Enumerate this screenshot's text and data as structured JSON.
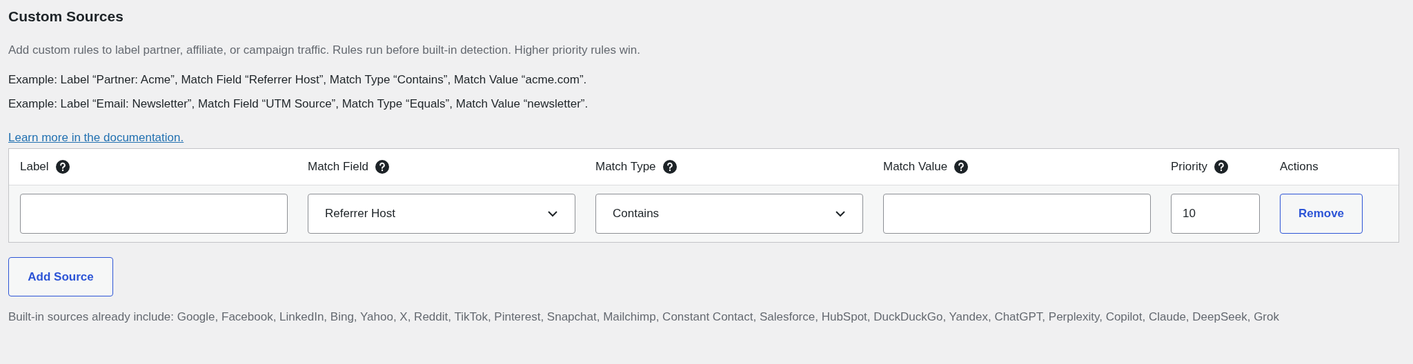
{
  "heading": "Custom Sources",
  "description": "Add custom rules to label partner, affiliate, or campaign traffic. Rules run before built-in detection. Higher priority rules win.",
  "examples": [
    "Example: Label “Partner: Acme”, Match Field “Referrer Host”, Match Type “Contains”, Match Value “acme.com”.",
    "Example: Label “Email: Newsletter”, Match Field “UTM Source”, Match Type “Equals”, Match Value “newsletter”."
  ],
  "doc_link": "Learn more in the documentation.",
  "table": {
    "columns": [
      {
        "label": "Label",
        "help": true
      },
      {
        "label": "Match Field",
        "help": true
      },
      {
        "label": "Match Type",
        "help": true
      },
      {
        "label": "Match Value",
        "help": true
      },
      {
        "label": "Priority",
        "help": true
      },
      {
        "label": "Actions",
        "help": false
      }
    ],
    "rows": [
      [
        {
          "kind": "text"
        },
        {
          "kind": "select",
          "value": "Referrer Host"
        },
        {
          "kind": "select",
          "value": "Contains"
        },
        {
          "kind": "text"
        },
        {
          "kind": "text",
          "value": "10"
        },
        {
          "kind": "button",
          "label": "Remove"
        }
      ]
    ]
  },
  "add_button": "Add Source",
  "builtin_note": "Built-in sources already include: Google, Facebook, LinkedIn, Bing, Yahoo, X, Reddit, TikTok, Pinterest, Snapchat, Mailchimp, Constant Contact, Salesforce, HubSpot, DuckDuckGo, Yandex, ChatGPT, Perplexity, Copilot, Claude, DeepSeek, Grok"
}
